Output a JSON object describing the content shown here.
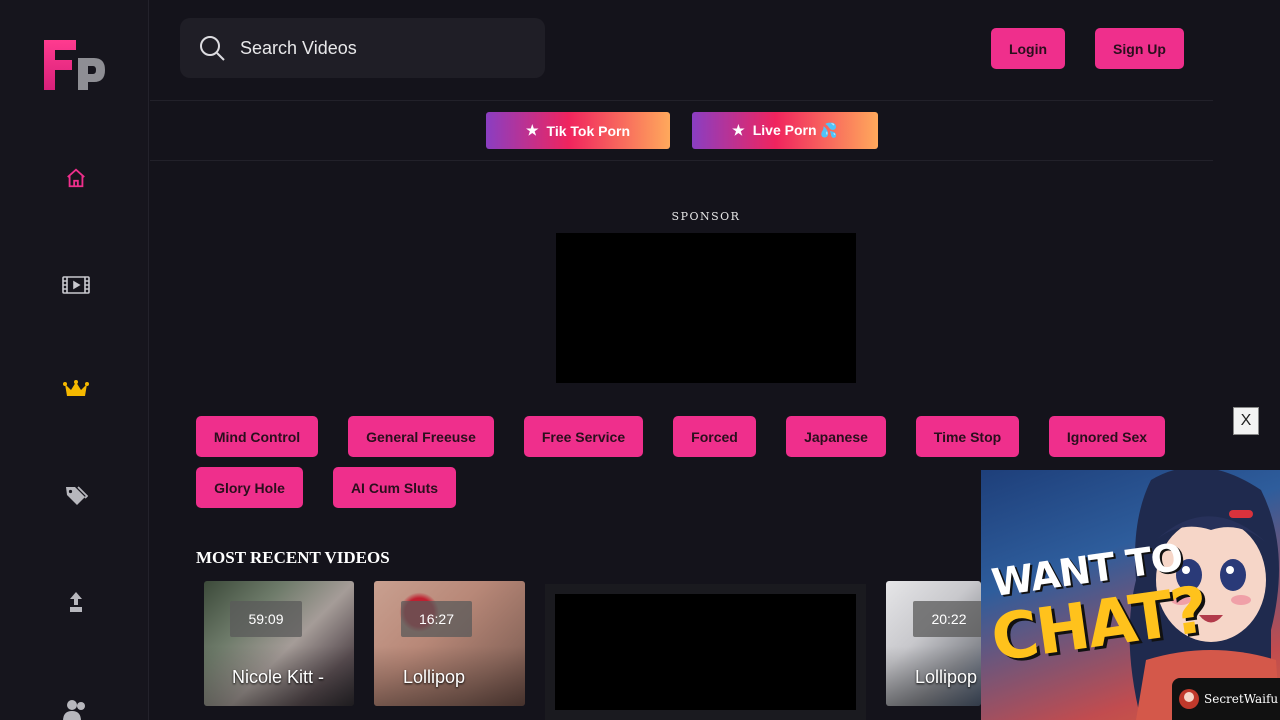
{
  "search": {
    "placeholder": "Search Videos"
  },
  "auth": {
    "login_label": "Login",
    "signup_label": "Sign Up"
  },
  "promos": [
    {
      "label": "Tik Tok Porn",
      "star": "★"
    },
    {
      "label": "Live Porn 💦",
      "star": "★"
    }
  ],
  "sponsor": {
    "label": "SPONSOR"
  },
  "tags": [
    "Mind Control",
    "General Freeuse",
    "Free Service",
    "Forced",
    "Japanese",
    "Time Stop",
    "Ignored Sex",
    "Glory Hole",
    "AI Cum Sluts"
  ],
  "section": {
    "title": "MOST RECENT VIDEOS"
  },
  "videos": [
    {
      "duration": "59:09",
      "title": "Nicole Kitt -"
    },
    {
      "duration": "16:27",
      "title": "Lollipop"
    },
    {
      "duration": "20:22",
      "title": "Lollipop"
    }
  ],
  "popup": {
    "close_label": "X",
    "line1": "WANT TO",
    "line2": "CHAT?",
    "brand": "SecretWaifu"
  },
  "colors": {
    "accent": "#ef2f8c",
    "background": "#14131b",
    "crown": "#f5b800"
  }
}
